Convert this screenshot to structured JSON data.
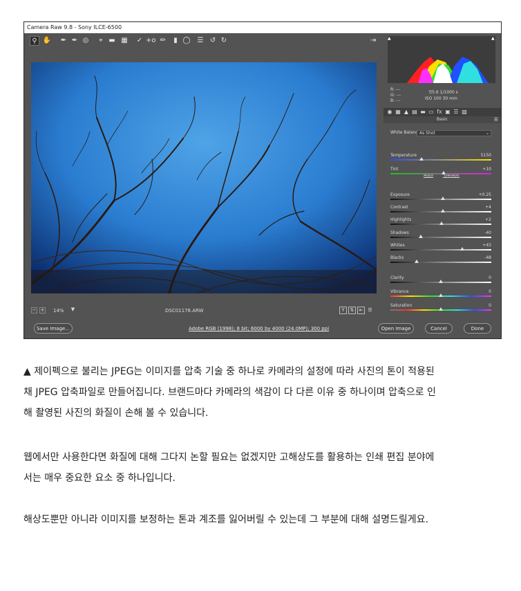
{
  "window": {
    "title": "Camera Raw 9.8  -  Sony ILCE-6500"
  },
  "toolbar": {
    "tools": [
      "zoom-tool",
      "hand-tool",
      "white-balance-tool",
      "color-sampler-tool",
      "targeted-adjustment-tool",
      "crop-tool",
      "straighten-tool",
      "transform-tool",
      "spot-removal-tool",
      "red-eye-tool",
      "adjustment-brush-tool",
      "graduated-filter-tool",
      "radial-filter-tool",
      "preferences",
      "rotate-ccw",
      "rotate-cw"
    ],
    "preview_icon": "toggle-fullscreen-icon"
  },
  "image": {
    "filename": "DSC01178.ARW",
    "zoom": "14%"
  },
  "bottom": {
    "save_label": "Save Image...",
    "workflow_info": "Adobe RGB (1998); 8 bit; 6000 by 4000 (24.0MP); 300 ppi",
    "open_label": "Open Image",
    "cancel_label": "Cancel",
    "done_label": "Done"
  },
  "info": {
    "r": "R:    ---",
    "g": "G:    ---",
    "b": "B:    ---",
    "exif_line1": "f/5.6   1/1000 s",
    "exif_line2": "ISO 100   30 mm"
  },
  "panel": {
    "title": "Basic",
    "white_balance_label": "White Balance:",
    "white_balance_value": "As Shot",
    "auto": "Auto",
    "default": "Default",
    "sliders": [
      {
        "label": "Temperature",
        "value": "5150",
        "pos": 0.31
      },
      {
        "label": "Tint",
        "value": "+10",
        "pos": 0.53
      },
      {
        "label": "Exposure",
        "value": "+0.25",
        "pos": 0.52
      },
      {
        "label": "Contrast",
        "value": "+4",
        "pos": 0.52
      },
      {
        "label": "Highlights",
        "value": "+2",
        "pos": 0.51
      },
      {
        "label": "Shadows",
        "value": "-40",
        "pos": 0.3
      },
      {
        "label": "Whites",
        "value": "+43",
        "pos": 0.71
      },
      {
        "label": "Blacks",
        "value": "-48",
        "pos": 0.26
      },
      {
        "label": "Clarity",
        "value": "0",
        "pos": 0.5
      },
      {
        "label": "Vibrance",
        "value": "0",
        "pos": 0.5
      },
      {
        "label": "Saturation",
        "value": "0",
        "pos": 0.5
      }
    ]
  },
  "article": {
    "p1_line1": "▲ 제이펙으로 불리는 JPEG는 이미지를 압축 기술 중 하나로 카메라의 설정에 따라 사진의 톤이 적용된",
    "p1_line2": "채 JPEG 압축파일로 만들어집니다. 브랜드마다 카메라의 색감이 다 다른 이유 중 하나이며 압축으로 인",
    "p1_line3": "해 촬영된 사진의 화질이 손해 볼 수 있습니다.",
    "p2_line1": "웹에서만 사용한다면 화질에 대해 그다지 논할 필요는 없겠지만 고해상도를 활용하는 인쇄 편집 분야에",
    "p2_line2": "서는 매우 중요한 요소 중 하나입니다.",
    "p3_line1": "해상도뿐만 아니라 이미지를 보정하는 톤과 계조를 잃어버릴 수 있는데 그 부분에 대해 설명드릴게요."
  }
}
